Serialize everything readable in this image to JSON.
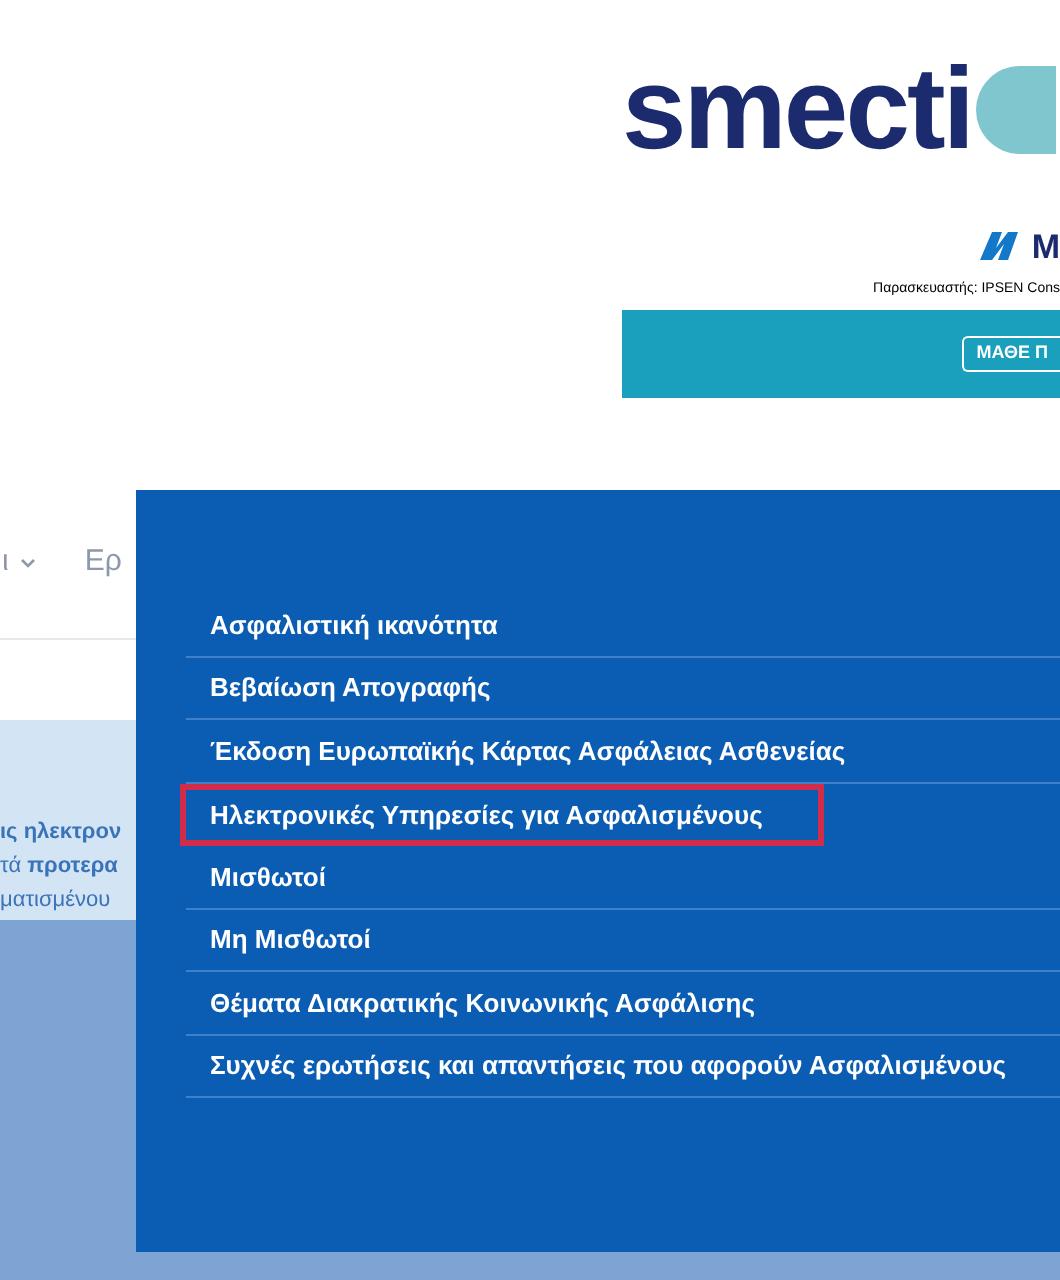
{
  "ad_banner": {
    "logo_text": "smecti",
    "brand_text": "M",
    "manufacturer": "Παρασκευαστής: IPSEN Cons",
    "button": "ΜΑΘΕ Π"
  },
  "nav": {
    "items": [
      {
        "label": "ι",
        "has_caret": true
      },
      {
        "label": "Ερ",
        "has_caret": false
      }
    ]
  },
  "notice": {
    "lines": [
      "ις ηλεκτρον",
      "τά **προτερα**",
      "ματισμένου"
    ]
  },
  "dropdown": {
    "items": [
      {
        "label": "Ασφαλιστική ικανότητα",
        "highlighted": false
      },
      {
        "label": "Βεβαίωση Απογραφής",
        "highlighted": false
      },
      {
        "label": "Έκδοση Ευρωπαϊκής Κάρτας Ασφάλειας Ασθενείας",
        "highlighted": false
      },
      {
        "label": "Ηλεκτρονικές Υπηρεσίες για Ασφαλισμένους",
        "highlighted": true
      },
      {
        "label": "Μισθωτοί",
        "highlighted": false
      },
      {
        "label": "Μη Μισθωτοί",
        "highlighted": false
      },
      {
        "label": "Θέματα Διακρατικής Κοινωνικής Ασφάλισης",
        "highlighted": false
      },
      {
        "label": "Συχνές ερωτήσεις και απαντήσεις που αφορούν Ασφαλισμένους",
        "highlighted": false
      }
    ]
  }
}
